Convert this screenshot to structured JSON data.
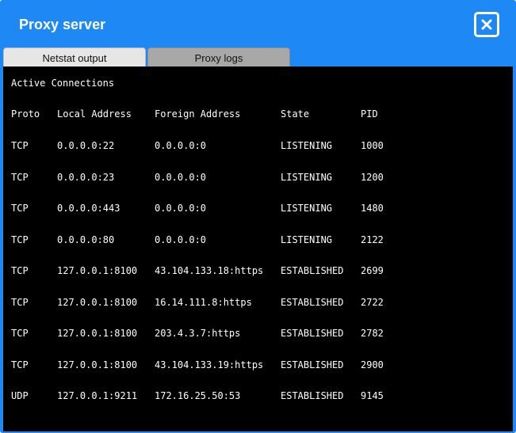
{
  "window": {
    "title": "Proxy server"
  },
  "tabs": [
    {
      "label": "Netstat output",
      "active": true
    },
    {
      "label": "Proxy logs",
      "active": false
    }
  ],
  "console": {
    "heading": "Active Connections",
    "headers": [
      "Proto",
      "Local Address",
      "Foreign Address",
      "State",
      "PID"
    ],
    "rows": [
      [
        "TCP",
        "0.0.0.0:22",
        "0.0.0.0:0",
        "LISTENING",
        "1000"
      ],
      [
        "TCP",
        "0.0.0.0:23",
        "0.0.0.0:0",
        "LISTENING",
        "1200"
      ],
      [
        "TCP",
        "0.0.0.0:443",
        "0.0.0.0:0",
        "LISTENING",
        "1480"
      ],
      [
        "TCP",
        "0.0.0.0:80",
        "0.0.0.0:0",
        "LISTENING",
        "2122"
      ],
      [
        "TCP",
        "127.0.0.1:8100",
        "43.104.133.18:https",
        "ESTABLISHED",
        "2699"
      ],
      [
        "TCP",
        "127.0.0.1:8100",
        "16.14.111.8:https",
        "ESTABLISHED",
        "2722"
      ],
      [
        "TCP",
        "127.0.0.1:8100",
        "203.4.3.7:https",
        "ESTABLISHED",
        "2782"
      ],
      [
        "TCP",
        "127.0.0.1:8100",
        "43.104.133.19:https",
        "ESTABLISHED",
        "2900"
      ],
      [
        "UDP",
        "127.0.0.1:9211",
        "172.16.25.50:53",
        "ESTABLISHED",
        "9145"
      ]
    ]
  },
  "colors": {
    "accent": "#1e88f5",
    "console_bg": "#000000",
    "tab_active": "#e6e6e6",
    "tab_inactive": "#a8a8a8"
  }
}
